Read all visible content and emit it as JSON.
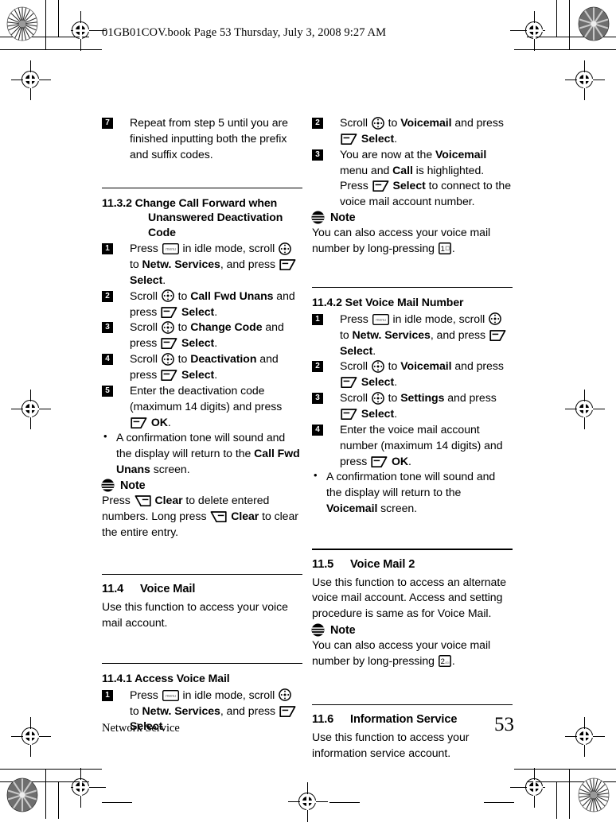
{
  "header": {
    "slug": "01GB01COV.book  Page 53  Thursday, July 3, 2008  9:27 AM"
  },
  "footer": {
    "running_title": "Network Service",
    "page_number": "53"
  },
  "icons": {
    "menu_key": "menu-key-icon",
    "menu_key_label": "menu",
    "scroll_key": "scroll-navigation-key-icon",
    "soft_key": "left-soft-key-icon",
    "clear_key": "right-soft-key-clear-icon",
    "note": "note-icon",
    "key_1": "numeric-key-1-icon",
    "key_1_label": "1",
    "key_2": "numeric-key-2-icon",
    "key_2_label": "2"
  },
  "left_column": {
    "step7": {
      "num": "7",
      "text": "Repeat from step 5 until you are finished inputting both the prefix and suffix codes."
    },
    "section_11_3_2": {
      "number": "11.3.2",
      "title": "Change Call Forward when Unanswered Deactivation Code",
      "steps": [
        {
          "num": "1",
          "parts": [
            "Press ",
            "[menu]",
            " in idle mode, scroll ",
            "[scroll]",
            " to ",
            "Netw. Services",
            ", and press ",
            "[soft]",
            " ",
            "Select",
            "."
          ]
        },
        {
          "num": "2",
          "parts": [
            "Scroll ",
            "[scroll]",
            " to ",
            "Call Fwd Unans",
            " and press ",
            "[soft]",
            " ",
            "Select",
            "."
          ]
        },
        {
          "num": "3",
          "parts": [
            "Scroll ",
            "[scroll]",
            " to ",
            "Change Code",
            " and press ",
            "[soft]",
            " ",
            "Select",
            "."
          ]
        },
        {
          "num": "4",
          "parts": [
            "Scroll ",
            "[scroll]",
            " to ",
            "Deactivation",
            " and press ",
            "[soft]",
            " ",
            "Select",
            "."
          ]
        },
        {
          "num": "5",
          "parts": [
            "Enter the deactivation code (maximum 14 digits) and press ",
            "[soft]",
            " ",
            "OK",
            "."
          ]
        }
      ],
      "bullet": {
        "pre": "A confirmation tone will sound and the display will return to the ",
        "bold": "Call Fwd Unans",
        "post": " screen."
      },
      "note": {
        "title": "Note",
        "parts": [
          "Press ",
          "[clear]",
          " ",
          "Clear",
          " to delete entered numbers. Long press ",
          "[clear]",
          " ",
          "Clear",
          " to clear the entire entry."
        ]
      }
    },
    "section_11_4": {
      "number": "11.4",
      "title": "Voice Mail",
      "body": "Use this function to access your voice mail account."
    },
    "section_11_4_1": {
      "number": "11.4.1",
      "title": "Access Voice Mail",
      "steps": [
        {
          "num": "1",
          "parts": [
            "Press ",
            "[menu]",
            " in idle mode, scroll ",
            "[scroll]",
            " to ",
            "Netw. Services",
            ", and press ",
            "[soft]",
            " ",
            "Select",
            "."
          ]
        }
      ]
    }
  },
  "right_column": {
    "continued_steps": [
      {
        "num": "2",
        "parts": [
          "Scroll ",
          "[scroll]",
          " to ",
          "Voicemail",
          " and press ",
          "[soft]",
          " ",
          "Select",
          "."
        ]
      },
      {
        "num": "3",
        "parts": [
          "You are now at the ",
          "Voicemail",
          " menu and ",
          "Call",
          " is highlighted. Press ",
          "[soft]",
          " ",
          "Select",
          " to connect to the voice mail account number."
        ]
      }
    ],
    "note_1": {
      "title": "Note",
      "parts": [
        "You can also access your voice mail number by long-pressing ",
        "[key1]",
        "."
      ]
    },
    "section_11_4_2": {
      "number": "11.4.2",
      "title": "Set Voice Mail Number",
      "steps": [
        {
          "num": "1",
          "parts": [
            "Press ",
            "[menu]",
            " in idle mode, scroll ",
            "[scroll]",
            " to ",
            "Netw. Services",
            ", and press ",
            "[soft]",
            " ",
            "Select",
            "."
          ]
        },
        {
          "num": "2",
          "parts": [
            "Scroll ",
            "[scroll]",
            " to ",
            "Voicemail",
            " and press ",
            "[soft]",
            " ",
            "Select",
            "."
          ]
        },
        {
          "num": "3",
          "parts": [
            "Scroll ",
            "[scroll]",
            " to ",
            "Settings",
            " and press ",
            "[soft]",
            " ",
            "Select",
            "."
          ]
        },
        {
          "num": "4",
          "parts": [
            "Enter the voice mail account number (maximum 14 digits) and press ",
            "[soft]",
            " ",
            "OK",
            "."
          ]
        }
      ],
      "bullet": {
        "pre": "A confirmation tone will sound and the display will return to the ",
        "bold": "Voicemail",
        "post": " screen."
      }
    },
    "section_11_5": {
      "number": "11.5",
      "title": "Voice Mail 2",
      "body": "Use this function to access an alternate voice mail account. Access and setting procedure is same as for Voice Mail.",
      "note": {
        "title": "Note",
        "parts": [
          "You can also access your voice mail number by long-pressing ",
          "[key2]",
          "."
        ]
      }
    },
    "section_11_6": {
      "number": "11.6",
      "title": "Information Service",
      "body": "Use this function to access your information service account."
    }
  }
}
